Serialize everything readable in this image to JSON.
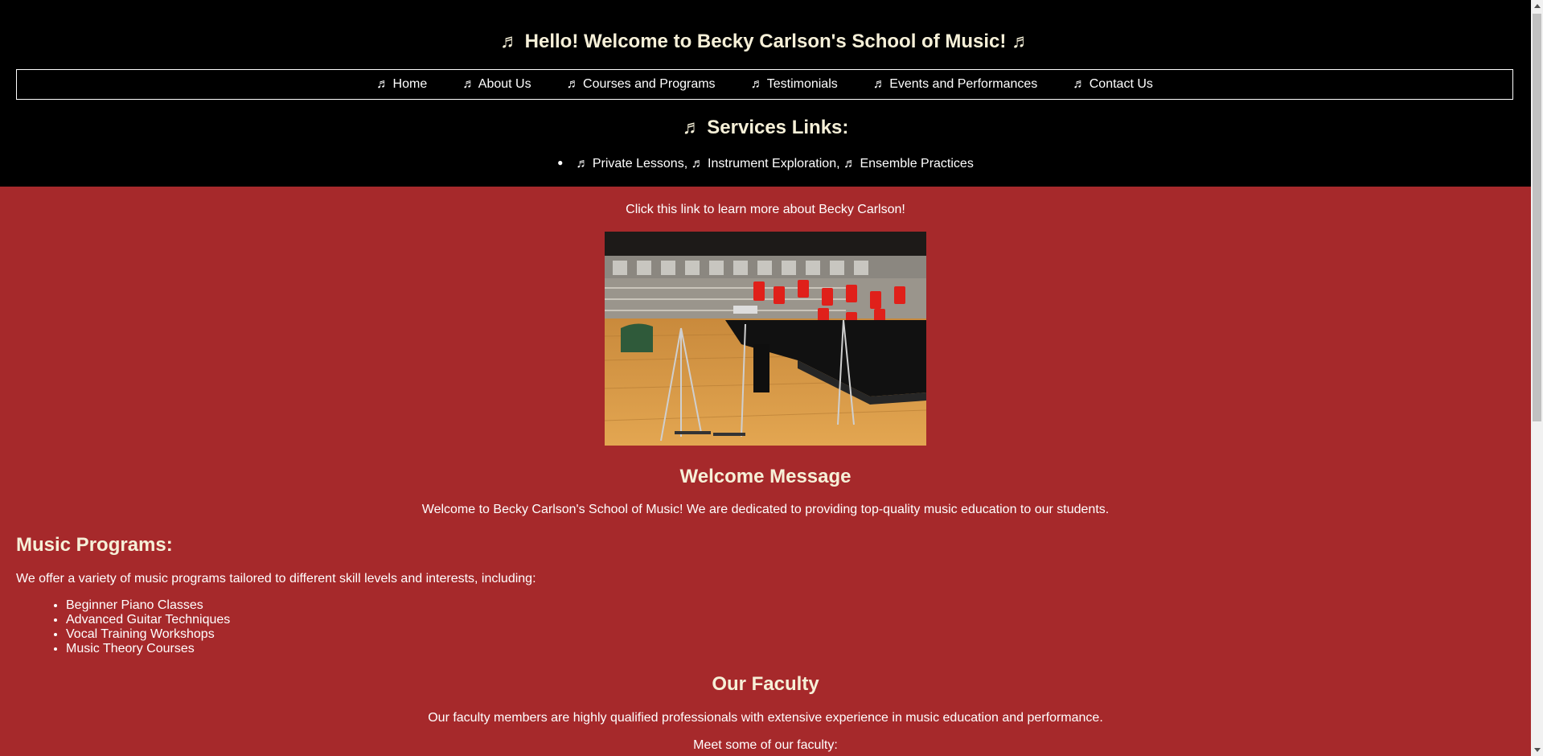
{
  "header": {
    "title": "♬ Hello! Welcome to Becky Carlson's School of Music! ♬",
    "nav": [
      {
        "label": "♬ Home"
      },
      {
        "label": "♬ About Us"
      },
      {
        "label": "♬ Courses and Programs"
      },
      {
        "label": "♬ Testimonials"
      },
      {
        "label": "♬ Events and Performances"
      },
      {
        "label": "♬ Contact Us"
      }
    ],
    "services_title": "♬ Services Links:",
    "services_text": "♬ Private Lessons, ♬ Instrument Exploration, ♬ Ensemble Practices"
  },
  "main": {
    "intro_link": "Click this link to learn more about Becky Carlson!",
    "welcome_heading": "Welcome Message",
    "welcome_text": "Welcome to Becky Carlson's School of Music! We are dedicated to providing top-quality music education to our students.",
    "programs": {
      "heading": "Music Programs:",
      "intro": "We offer a variety of music programs tailored to different skill levels and interests, including:",
      "items": [
        "Beginner Piano Classes",
        "Advanced Guitar Techniques",
        "Vocal Training Workshops",
        "Music Theory Courses"
      ]
    },
    "faculty": {
      "heading": "Our Faculty",
      "text": "Our faculty members are highly qualified professionals with extensive experience in music education and performance.",
      "meet": "Meet some of our faculty:"
    }
  },
  "colors": {
    "page_background": "#a6292b",
    "header_background": "#000000",
    "heading_text": "#f6f0d8",
    "body_text": "#ffffff"
  },
  "icons": {
    "music_note": "music-note-icon",
    "photo": "concert-hall-photo"
  }
}
